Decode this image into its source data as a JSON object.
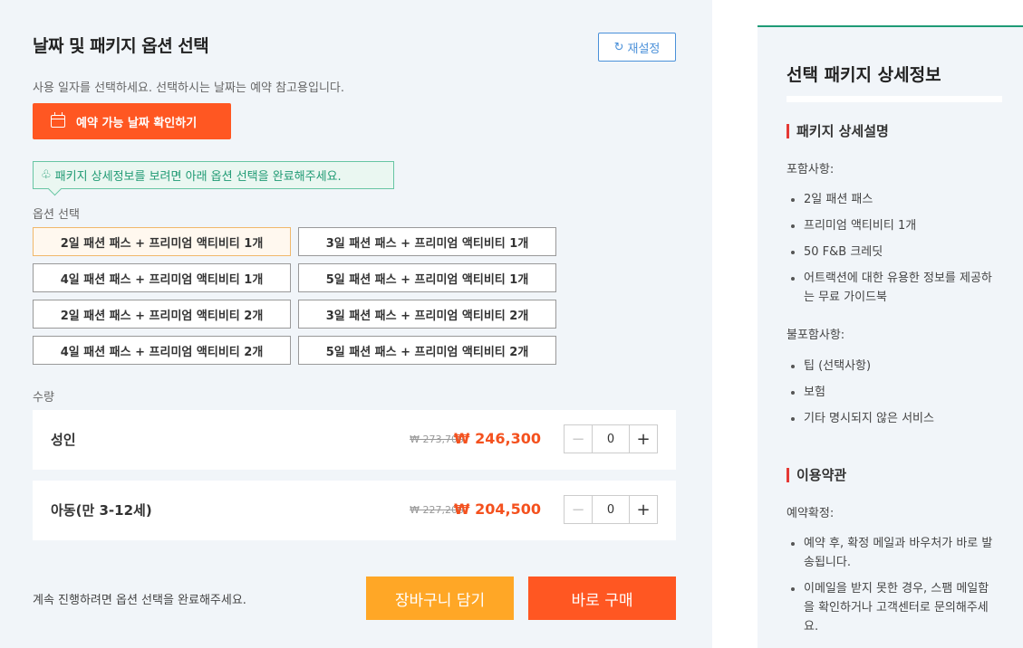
{
  "booking": {
    "title": "날짜 및 패키지 옵션 선택",
    "reset_label": "재설정",
    "subtitle": "사용 일자를 선택하세요. 선택하시는 날짜는 예약 참고용입니다.",
    "check_date_label": "예약 가능 날짜 확인하기",
    "hint": "패키지 상세정보를 보려면 아래 옵션 선택을 완료해주세요.",
    "options_label": "옵션 선택",
    "options": [
      "2일 패션 패스 + 프리미엄 액티비티 1개",
      "3일 패션 패스 + 프리미엄 액티비티 1개",
      "4일 패션 패스 + 프리미엄 액티비티 1개",
      "5일 패션 패스 + 프리미엄 액티비티 1개",
      "2일 패션 패스 + 프리미엄 액티비티 2개",
      "3일 패션 패스 + 프리미엄 액티비티 2개",
      "4일 패션 패스 + 프리미엄 액티비티 2개",
      "5일 패션 패스 + 프리미엄 액티비티 2개"
    ],
    "selected_option": "2일 패션 패스 + 프리미엄 액티비티 1개",
    "quantity_label": "수량",
    "quantities": [
      {
        "name": "성인",
        "old_price": "₩ 273,700",
        "new_price": "₩ 246,300",
        "value": "0",
        "minus": "−",
        "plus": "+"
      },
      {
        "name": "아동(만 3-12세)",
        "old_price": "₩ 227,200",
        "new_price": "₩ 204,500",
        "value": "0",
        "minus": "−",
        "plus": "+"
      }
    ],
    "footer_message": "계속 진행하려면 옵션 선택을 완료해주세요.",
    "cart_label": "장바구니 담기",
    "buy_label": "바로 구매"
  },
  "details": {
    "title": "선택 패키지 상세정보",
    "package_section": "패키지 상세설명",
    "includes_label": "포함사항:",
    "includes": [
      "2일 패션 패스",
      "프리미엄 액티비티 1개",
      "50 F&B 크레딧",
      "어트랙션에 대한 유용한 정보를 제공하는 무료 가이드북"
    ],
    "excludes_label": "불포함사항:",
    "excludes": [
      "팁 (선택사항)",
      "보험",
      "기타 명시되지 않은 서비스"
    ],
    "terms_section": "이용약관",
    "confirm_label": "예약확정:",
    "confirm_items": [
      "예약 후, 확정 메일과 바우처가 바로 발송됩니다.",
      "이메일을 받지 못한 경우, 스팸 메일함을 확인하거나 고객센터로 문의해주세요."
    ]
  },
  "icons": {
    "reset": "refresh-icon",
    "calendar": "calendar-icon",
    "hint": "lightbulb-icon"
  },
  "colors": {
    "accent_orange": "#ff5722",
    "cart_orange": "#ffa726",
    "price_red": "#f4511e",
    "hint_green": "#1f9a73",
    "reset_blue": "#4a90d9",
    "section_marker": "#e53935"
  }
}
